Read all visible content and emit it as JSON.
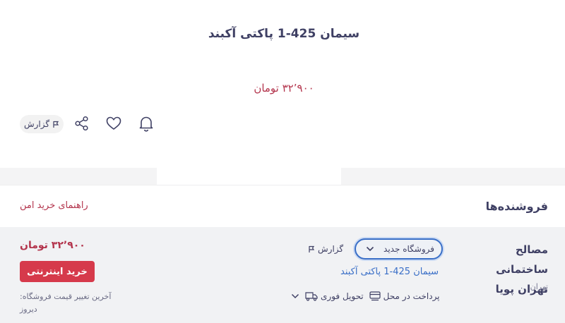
{
  "product": {
    "title": "سیمان 425-1 پاکتی آکبند",
    "price": "۳۲٬۹۰۰ تومان",
    "report_label": "گزارش"
  },
  "icons": {
    "share": "share-icon",
    "favorite": "heart-icon",
    "notify": "bell-icon",
    "report": "flag-icon"
  },
  "sellers": {
    "title": "فروشنده‌ها",
    "safe_guide": "راهنمای خرید امن",
    "rows": [
      {
        "name": "مصالح ساختمانی تهران پویا",
        "city": "تهران",
        "store_select": "فروشگاه جدید",
        "report_label": "گزارش",
        "product_link": "سیمان 425-1 پاکتی آکبند",
        "features": [
          "پرداخت در محل",
          "تحویل فوری"
        ],
        "price": "۳۲٬۹۰۰ تومان",
        "buy_label": "خرید اینترنتی",
        "last_change_label": "آخرین تغییر قیمت فروشگاه:",
        "last_change_value": "دیروز"
      }
    ]
  },
  "colors": {
    "accent_red": "#d63a4b",
    "price_red": "#b3344c",
    "link_blue": "#3a6fc7",
    "text": "#3f4064"
  }
}
